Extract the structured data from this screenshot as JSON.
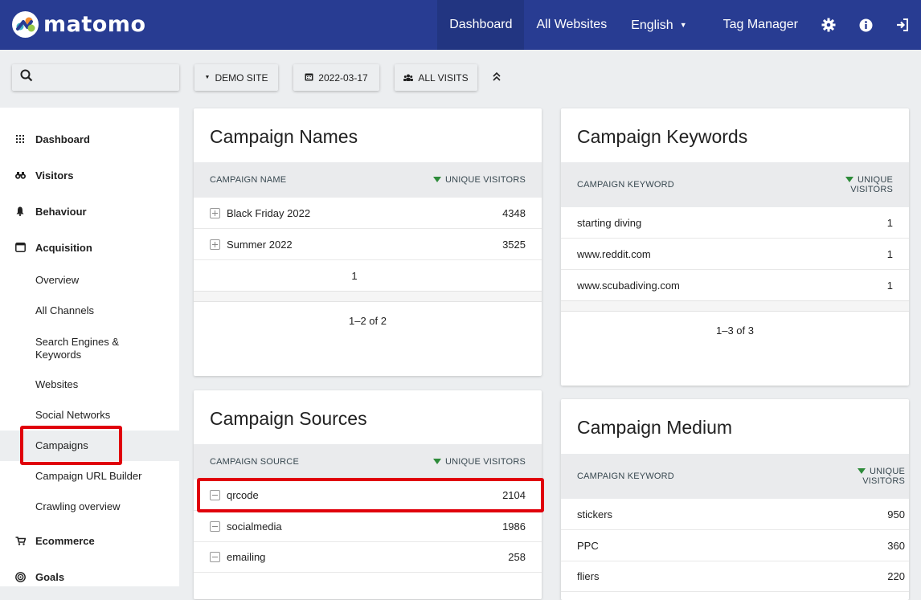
{
  "topbar": {
    "brand": "matomo",
    "nav": [
      {
        "label": "Dashboard",
        "active": true
      },
      {
        "label": "All Websites"
      },
      {
        "label": "English"
      },
      {
        "label": "Tag Manager"
      }
    ],
    "icons": [
      "gear-icon",
      "info-icon",
      "logout-icon"
    ]
  },
  "toolbar": {
    "search_placeholder": "",
    "site_selector": "DEMO SITE",
    "date_selector": "2022-03-17",
    "segment_selector": "ALL VISITS"
  },
  "sidebar": {
    "sections": [
      {
        "label": "Dashboard",
        "icon": "grid-icon"
      },
      {
        "label": "Visitors",
        "icon": "binoculars-icon"
      },
      {
        "label": "Behaviour",
        "icon": "bell-icon"
      },
      {
        "label": "Acquisition",
        "icon": "window-icon"
      }
    ],
    "acquisition_items": [
      {
        "label": "Overview"
      },
      {
        "label": "All Channels"
      },
      {
        "label": "Search Engines & Keywords"
      },
      {
        "label": "Websites"
      },
      {
        "label": "Social Networks"
      },
      {
        "label": "Campaigns",
        "active": true
      },
      {
        "label": "Campaign URL Builder"
      },
      {
        "label": "Crawling overview"
      }
    ],
    "more_sections": [
      {
        "label": "Ecommerce",
        "icon": "cart-icon"
      },
      {
        "label": "Goals",
        "icon": "target-icon"
      }
    ]
  },
  "widgets": {
    "campaign_names": {
      "title": "Campaign Names",
      "col_label": "CAMPAIGN NAME",
      "col_metric": "UNIQUE VISITORS",
      "rows": [
        {
          "name": "Black Friday 2022",
          "value": "4348"
        },
        {
          "name": "Summer 2022",
          "value": "3525"
        }
      ],
      "page": "1",
      "range": "1–2 of 2"
    },
    "campaign_keywords": {
      "title": "Campaign Keywords",
      "col_label": "CAMPAIGN KEYWORD",
      "col_metric_1": "UNIQUE",
      "col_metric_2": "VISITORS",
      "rows": [
        {
          "name": "starting diving",
          "value": "1"
        },
        {
          "name": "www.reddit.com",
          "value": "1"
        },
        {
          "name": "www.scubadiving.com",
          "value": "1"
        }
      ],
      "range": "1–3 of 3"
    },
    "campaign_sources": {
      "title": "Campaign Sources",
      "col_label": "CAMPAIGN SOURCE",
      "col_metric": "UNIQUE VISITORS",
      "rows": [
        {
          "name": "qrcode",
          "value": "2104"
        },
        {
          "name": "socialmedia",
          "value": "1986"
        },
        {
          "name": "emailing",
          "value": "258"
        }
      ]
    },
    "campaign_medium": {
      "title": "Campaign Medium",
      "col_label": "CAMPAIGN KEYWORD",
      "col_metric_1": "UNIQUE",
      "col_metric_2": "VISITORS",
      "rows": [
        {
          "name": "stickers",
          "value": "950"
        },
        {
          "name": "PPC",
          "value": "360"
        },
        {
          "name": "fliers",
          "value": "220"
        }
      ]
    }
  },
  "colors": {
    "header_bg": "#283c92",
    "sort_arrow": "#2e8b3a",
    "highlight": "#e0000b"
  }
}
